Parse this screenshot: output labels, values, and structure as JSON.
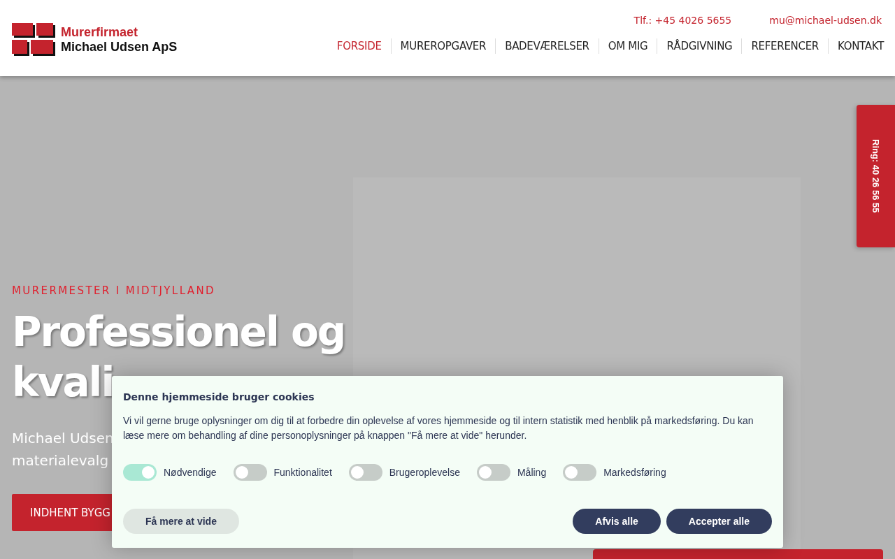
{
  "logo": {
    "line_1": "Murerfirmaet",
    "line_2": "Michael Udsen ApS"
  },
  "contact": {
    "phone": "Tlf.: +45 4026 5655",
    "email": "mu@michael-udsen.dk"
  },
  "nav": [
    {
      "label": "FORSIDE",
      "selected": true
    },
    {
      "label": "MUREROPGAVER",
      "selected": false
    },
    {
      "label": "BADEVÆRELSER",
      "selected": false
    },
    {
      "label": "OM MIG",
      "selected": false
    },
    {
      "label": "RÅDGIVNING",
      "selected": false
    },
    {
      "label": "REFERENCER",
      "selected": false
    },
    {
      "label": "KONTAKT",
      "selected": false
    }
  ],
  "side_tab": "Ring: 40 26 56 55",
  "hero": {
    "eyebrow": "MURERMESTER I MIDTJYLLAND",
    "heading_lines": [
      "Professionel og",
      "kvali"
    ],
    "subtitle_lines": [
      "Michael Udsen",
      "materialevalg"
    ],
    "button": "INDHENT BYGG"
  },
  "cookie_dialog": {
    "title": "Denne hjemmeside bruger cookies",
    "text": "Vi vil gerne bruge oplysninger om dig til at forbedre din oplevelse af vores hjemmeside og til intern statistik med henblik på markedsføring. Du kan læse mere om behandling af dine personoplysninger på knappen \"Få mere at vide\" herunder.",
    "toggles": [
      {
        "label": "Nødvendige",
        "on": true
      },
      {
        "label": "Funktionalitet",
        "on": false
      },
      {
        "label": "Brugeroplevelse",
        "on": false
      },
      {
        "label": "Måling",
        "on": false
      },
      {
        "label": "Markedsføring",
        "on": false
      }
    ],
    "more_button": "Få mere at vide",
    "reject_button": "Afvis alle",
    "accept_button": "Accepter alle"
  }
}
